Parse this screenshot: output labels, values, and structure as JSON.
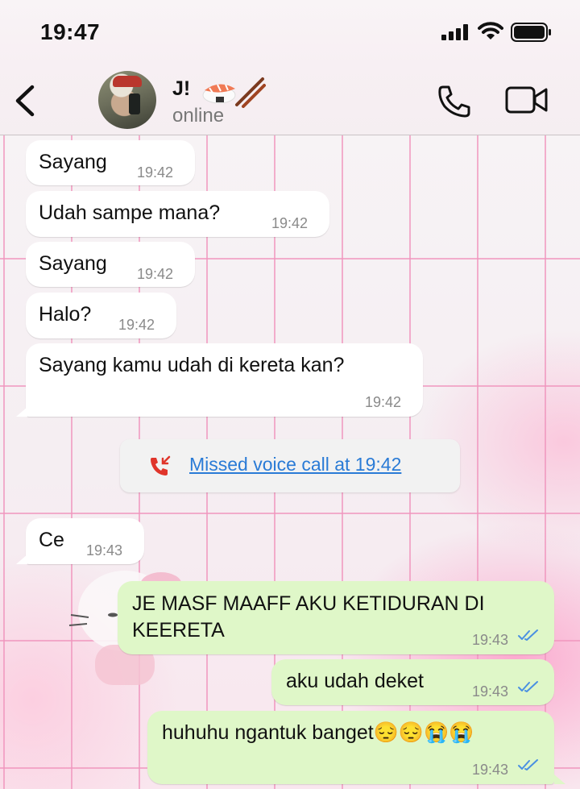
{
  "status_bar": {
    "time": "19:47"
  },
  "header": {
    "contact_name": "J!",
    "contact_status": "online",
    "emoji_icons": [
      "sushi-icon",
      "chopsticks-icon"
    ]
  },
  "messages": [
    {
      "direction": "in",
      "text": "Sayang",
      "time": "19:42"
    },
    {
      "direction": "in",
      "text": "Udah sampe mana?",
      "time": "19:42"
    },
    {
      "direction": "in",
      "text": "Sayang",
      "time": "19:42"
    },
    {
      "direction": "in",
      "text": "Halo?",
      "time": "19:42"
    },
    {
      "direction": "in",
      "text": "Sayang kamu udah di kereta kan?",
      "time": "19:42"
    },
    {
      "direction": "system",
      "text": "Missed voice call at 19:42"
    },
    {
      "direction": "in",
      "text": "Ce",
      "time": "19:43"
    },
    {
      "direction": "out",
      "text_line1": "JE MASF MAAFF AKU KETIDURAN DI",
      "text_line2": "KEERETA",
      "time": "19:43",
      "status": "read"
    },
    {
      "direction": "out",
      "text": "aku udah deket",
      "time": "19:43",
      "status": "read"
    },
    {
      "direction": "out",
      "text": "huhuhu ngantuk banget😔😔😭😭",
      "time": "19:43",
      "status": "read"
    }
  ],
  "colors": {
    "outgoing_bubble": "#dff7c8",
    "incoming_bubble": "#ffffff",
    "missed_call_red": "#e0352b",
    "link_blue": "#2a7bd6",
    "read_tick_blue": "#4a90e2",
    "wallpaper_grid_pink": "#f096be"
  }
}
